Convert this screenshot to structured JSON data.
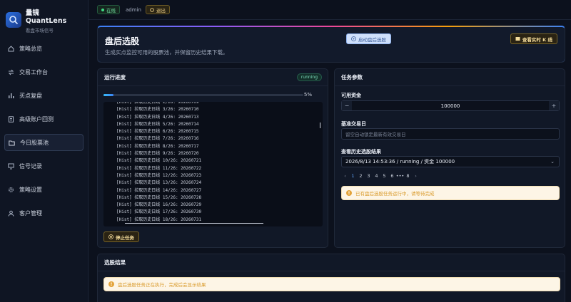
{
  "brand": {
    "title": "量镜 QuantLens",
    "subtitle": "看盘市场信号"
  },
  "sidebar": {
    "items": [
      {
        "label": "策略总览",
        "icon": "home-icon"
      },
      {
        "label": "交易工作台",
        "icon": "swap-icon"
      },
      {
        "label": "买点复盘",
        "icon": "bar-chart-icon"
      },
      {
        "label": "高级账户回测",
        "icon": "document-icon"
      },
      {
        "label": "今日股票池",
        "icon": "folder-icon",
        "active": true
      },
      {
        "label": "信号记录",
        "icon": "monitor-icon"
      },
      {
        "label": "策略设置",
        "icon": "gear-icon"
      },
      {
        "label": "客户管理",
        "icon": "user-icon"
      }
    ]
  },
  "topbar": {
    "status": "在线",
    "user": "admin",
    "logout": "退出"
  },
  "hero": {
    "title": "盘后选股",
    "description": "生成买点监控可用的股票池，并保留历史结果下载。",
    "start_button": "启动盘后选股",
    "kline_button": "查看实时 K 线"
  },
  "run_panel": {
    "title": "运行进度",
    "status_badge": "running",
    "progress_percent": 5,
    "progress_label": "5%",
    "log_lines": [
      "[Hist] 拉取历史日线 2/26: 20260709",
      "[Hist] 拉取历史日线 3/26: 20260710",
      "[Hist] 拉取历史日线 4/26: 20260713",
      "[Hist] 拉取历史日线 5/26: 20260714",
      "[Hist] 拉取历史日线 6/26: 20260715",
      "[Hist] 拉取历史日线 7/26: 20260716",
      "[Hist] 拉取历史日线 8/26: 20260717",
      "[Hist] 拉取历史日线 9/26: 20260720",
      "[Hist] 拉取历史日线 10/26: 20260721",
      "[Hist] 拉取历史日线 11/26: 20260722",
      "[Hist] 拉取历史日线 12/26: 20260723",
      "[Hist] 拉取历史日线 13/26: 20260724",
      "[Hist] 拉取历史日线 14/26: 20260727",
      "[Hist] 拉取历史日线 15/26: 20260728",
      "[Hist] 拉取历史日线 16/26: 20260729",
      "[Hist] 拉取历史日线 17/26: 20260730",
      "[Hist] 拉取历史日线 18/26: 20260731"
    ],
    "stop_button": "停止任务"
  },
  "params_panel": {
    "title": "任务参数",
    "capital_label": "可用资金",
    "capital_value": "100000",
    "minus": "−",
    "plus": "+",
    "date_label": "基准交易日",
    "date_placeholder": "留空自动锁定最新有效交易日",
    "history_label": "查看历史选股结果",
    "history_selected": "2026/8/13 14:53:36 / running / 资金 100000",
    "pages": [
      "1",
      "2",
      "3",
      "4",
      "5",
      "6",
      "•••",
      "8"
    ],
    "prev": "‹",
    "next": "›",
    "warning": "已有盘后选股任务运行中，请等待完成"
  },
  "results_panel": {
    "title": "选股结果",
    "info": "盘后选股任务正在执行，完成后会显示结果"
  },
  "colors": {
    "accent": "#3b82f6",
    "warning": "#e3a33a",
    "online": "#3ddc84"
  }
}
